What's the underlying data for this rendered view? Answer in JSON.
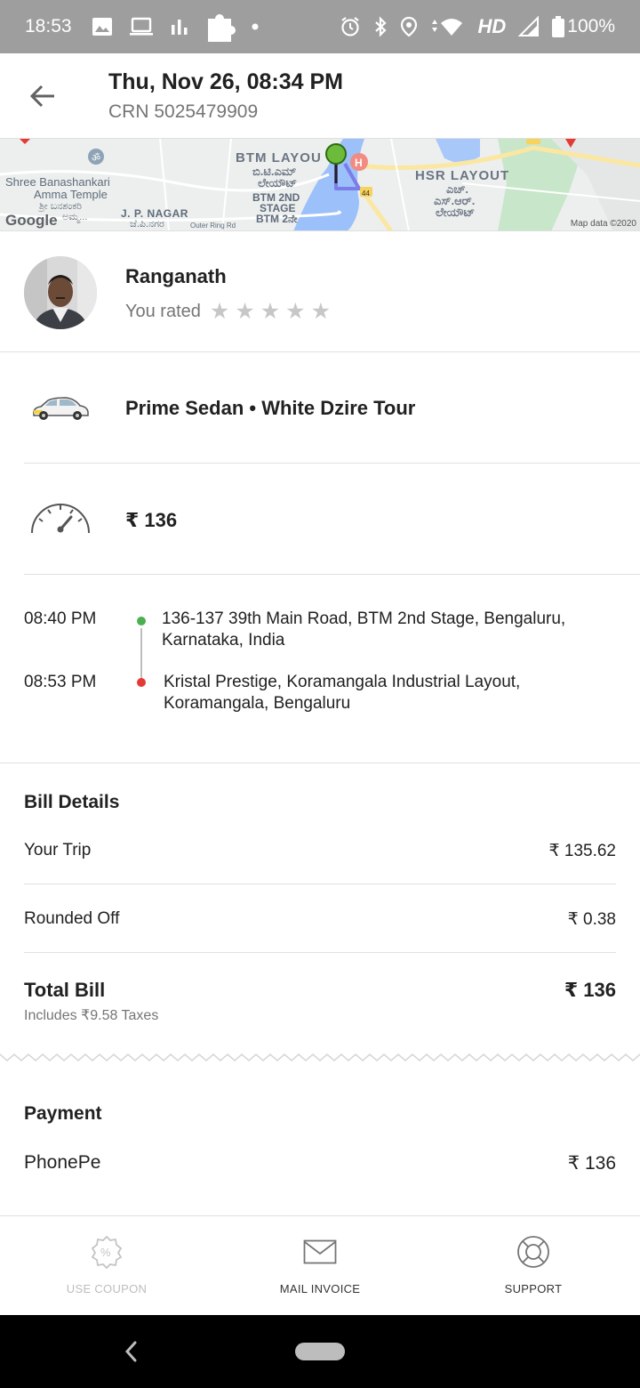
{
  "status_bar": {
    "time": "18:53",
    "network": "HD",
    "battery": "100%"
  },
  "header": {
    "title": "Thu, Nov 26, 08:34 PM",
    "crn": "CRN 5025479909"
  },
  "map": {
    "labels": {
      "btm_layout": "BTM LAYOU",
      "btm_layout_kn1": "ಬಿ.ಟಿ.ಎಮ್",
      "btm_layout_kn2": "ಲೇಯೌಟ್",
      "btm_2nd_1": "BTM 2ND",
      "btm_2nd_2": "STAGE",
      "btm_2nd_3": "BTM 2ನೇ",
      "hsr_layout": "HSR LAYOUT",
      "hsr_kn1": "ಎಚ್.",
      "hsr_kn2": "ಎಸ್.ಆರ್.",
      "hsr_kn3": "ಲೇಯೌಟ್",
      "shree_1": "Shree Banashankari",
      "shree_2": "Amma Temple",
      "shree_kn": "ಶ್ರೀ ಬನಶಂಕರಿ",
      "shree_kn2": "ಅಮ್ಮ...",
      "jp_nagar": "J. P. NAGAR",
      "jp_nagar_kn": "ಜೆ.ಪಿ.ನಗರ",
      "outer_ring": "Outer Ring Rd",
      "highway": "44"
    },
    "attribution": "Map data ©2020",
    "logo": "Google"
  },
  "driver": {
    "name": "Ranganath",
    "rated_label": "You rated",
    "rating": 0,
    "stars": [
      "★",
      "★",
      "★",
      "★",
      "★"
    ]
  },
  "vehicle": {
    "description": "Prime Sedan • White Dzire Tour"
  },
  "fare": {
    "amount": "₹ 136"
  },
  "route": {
    "pickup": {
      "time": "08:40 PM",
      "address": "136-137 39th Main Road, BTM 2nd Stage, Bengaluru, Karnataka, India"
    },
    "drop": {
      "time": "08:53 PM",
      "address": "Kristal Prestige, Koramangala Industrial Layout, Koramangala, Bengaluru"
    },
    "pickup_color": "#4caf50",
    "drop_color": "#e53935"
  },
  "bill": {
    "title": "Bill Details",
    "your_trip_label": "Your Trip",
    "your_trip_value": "₹ 135.62",
    "rounded_label": "Rounded Off",
    "rounded_value": "₹ 0.38",
    "total_label": "Total Bill",
    "total_value": "₹ 136",
    "taxes_note": "Includes ₹9.58 Taxes"
  },
  "payment": {
    "title": "Payment",
    "method": "PhonePe",
    "amount": "₹ 136"
  },
  "actions": {
    "coupon": "USE COUPON",
    "invoice": "MAIL INVOICE",
    "support": "SUPPORT"
  }
}
